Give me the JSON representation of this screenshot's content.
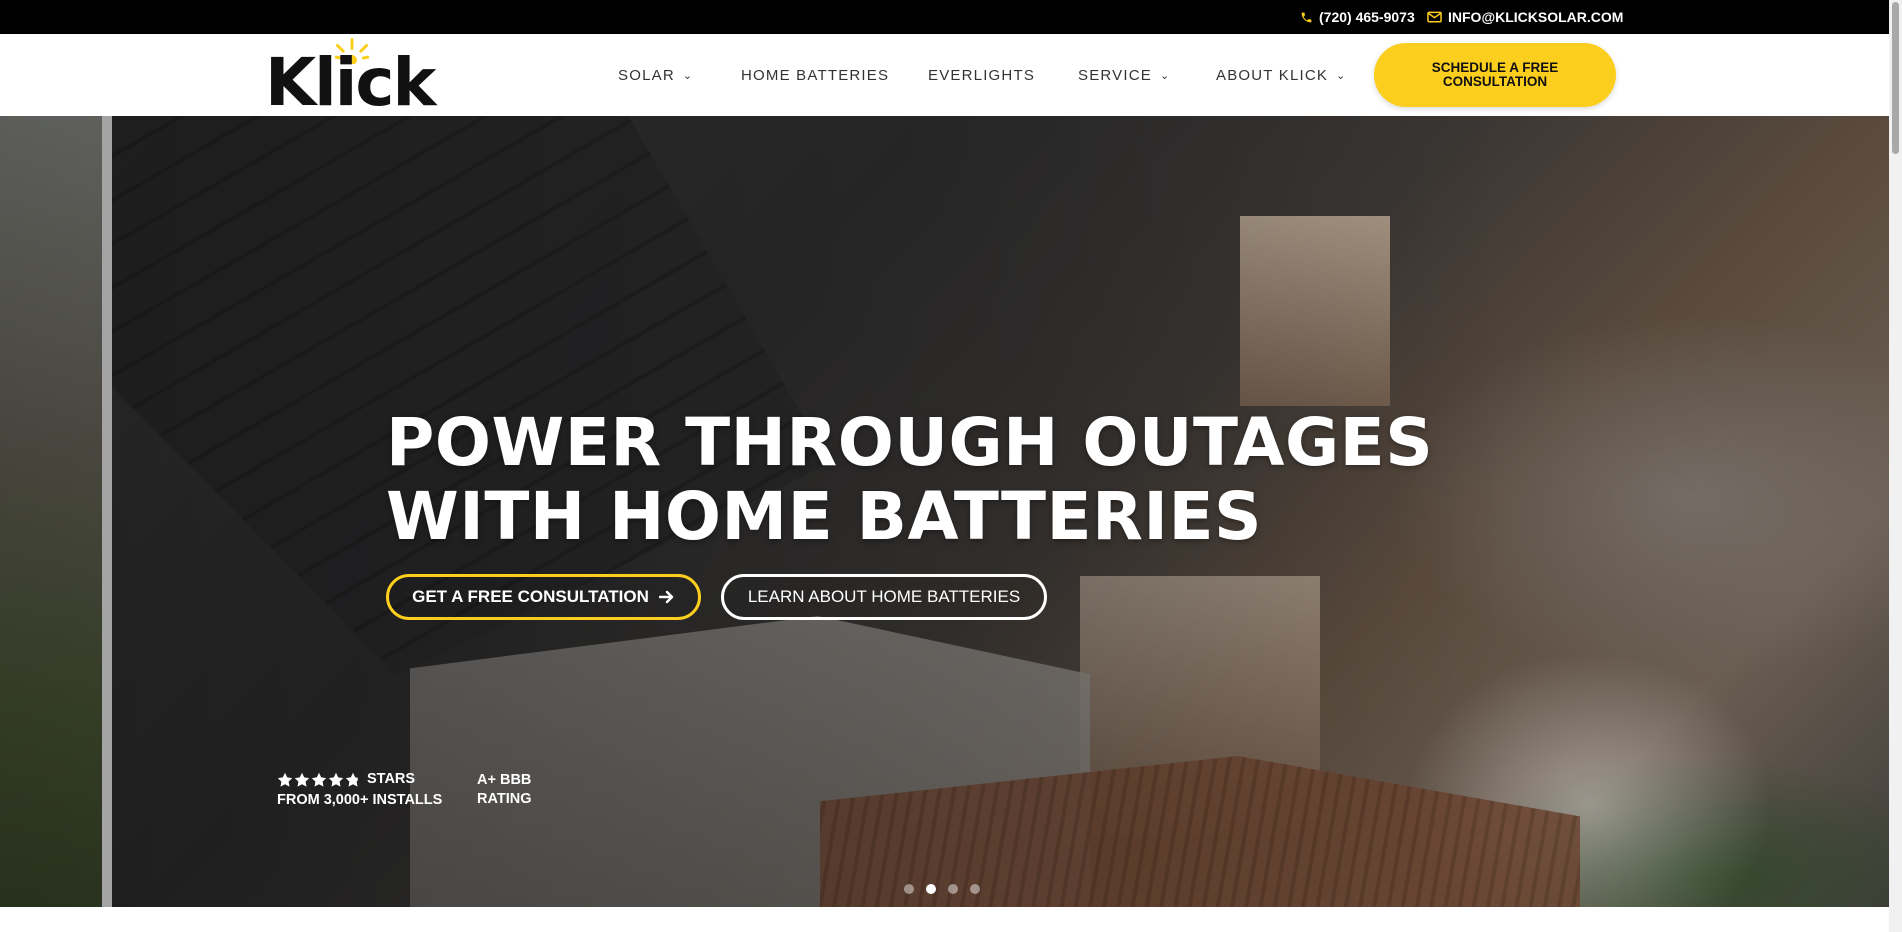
{
  "topbar": {
    "phone": "(720) 465-9073",
    "email": "INFO@KLICKSOLAR.COM",
    "phone_icon": "phone-icon",
    "email_icon": "envelope-icon"
  },
  "brand": {
    "logo_text": "Klick",
    "accent_color": "#fccf1f",
    "dark_color": "#111111"
  },
  "nav": {
    "items": [
      {
        "label": "SOLAR",
        "has_dropdown": true
      },
      {
        "label": "HOME BATTERIES",
        "has_dropdown": false
      },
      {
        "label": "EVERLIGHTS",
        "has_dropdown": false
      },
      {
        "label": "SERVICE",
        "has_dropdown": true
      },
      {
        "label": "ABOUT KLICK",
        "has_dropdown": true
      }
    ],
    "cta": "SCHEDULE A FREE CONSULTATION"
  },
  "hero": {
    "title_line1": "POWER THROUGH OUTAGES",
    "title_line2": "WITH HOME BATTERIES",
    "primary_button": "GET A FREE CONSULTATION",
    "secondary_button": "LEARN ABOUT HOME BATTERIES",
    "rating": {
      "stars_value": 4.8,
      "stars_max": 5,
      "label1": "STARS",
      "label2": "FROM 3,000+ INSTALLS"
    },
    "bbb": {
      "line1": "A+ BBB",
      "line2": "RATING"
    },
    "slider": {
      "total": 4,
      "active_index": 1
    }
  }
}
